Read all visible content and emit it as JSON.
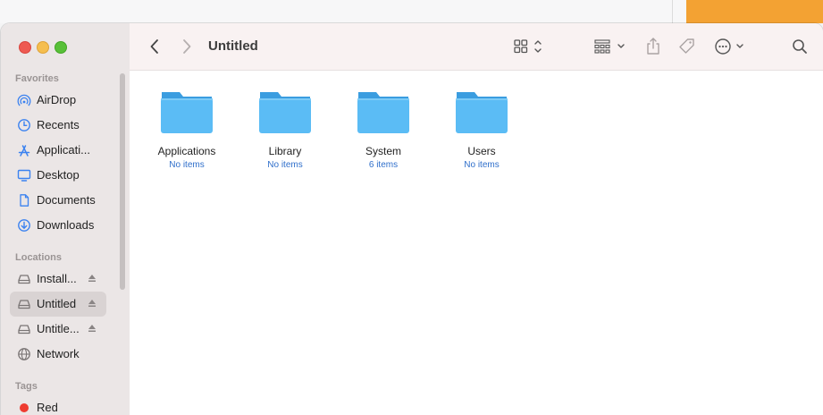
{
  "window": {
    "title": "Untitled"
  },
  "sidebar": {
    "sections": [
      {
        "header": "Favorites",
        "items": [
          {
            "label": "AirDrop",
            "icon": "airdrop-icon"
          },
          {
            "label": "Recents",
            "icon": "clock-icon"
          },
          {
            "label": "Applicati...",
            "icon": "applications-icon"
          },
          {
            "label": "Desktop",
            "icon": "desktop-icon"
          },
          {
            "label": "Documents",
            "icon": "document-icon"
          },
          {
            "label": "Downloads",
            "icon": "download-icon"
          }
        ]
      },
      {
        "header": "Locations",
        "items": [
          {
            "label": "Install...",
            "icon": "drive-icon",
            "eject": true
          },
          {
            "label": "Untitled",
            "icon": "drive-icon",
            "eject": true,
            "selected": true
          },
          {
            "label": "Untitle...",
            "icon": "drive-icon",
            "eject": true
          },
          {
            "label": "Network",
            "icon": "network-icon"
          }
        ]
      },
      {
        "header": "Tags",
        "items": [
          {
            "label": "Red",
            "icon": "red-tag-dot",
            "color": "#ee3b30"
          }
        ]
      }
    ]
  },
  "toolbar": {
    "back_icon": "chevron-left-icon",
    "forward_icon": "chevron-right-icon",
    "view_icon": "grid-view-icon",
    "group_icon": "group-by-icon",
    "share_icon": "share-icon",
    "tag_icon": "tag-icon",
    "more_icon": "ellipsis-circle-icon",
    "search_icon": "search-icon"
  },
  "content": {
    "items": [
      {
        "name": "Applications",
        "meta": "No items"
      },
      {
        "name": "Library",
        "meta": "No items"
      },
      {
        "name": "System",
        "meta": "6 items"
      },
      {
        "name": "Users",
        "meta": "No items"
      }
    ]
  },
  "colors": {
    "accent": "#2f6fcb",
    "folder": "#5bbcf5",
    "folder_tab": "#3a9de0",
    "sidebar": "#ebe6e6",
    "selected": "#d9d3d3"
  }
}
